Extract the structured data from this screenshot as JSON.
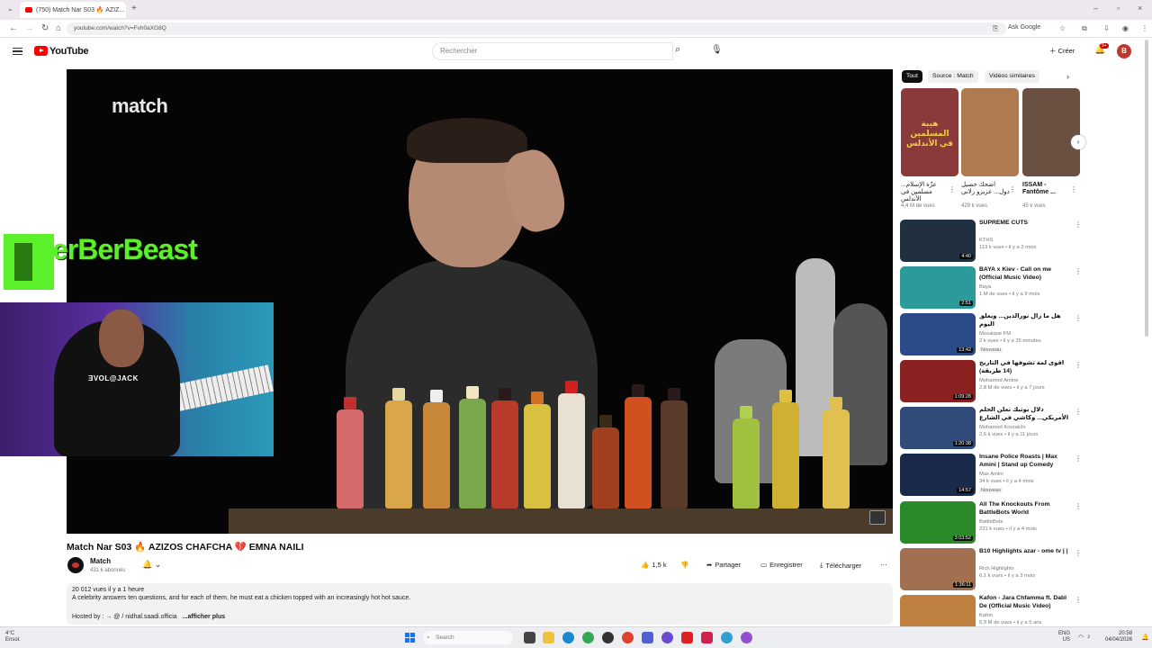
{
  "browser": {
    "tab_title": "(750) Match Nar S03 🔥 AZIZ...",
    "url": "youtube.com/watch?v=Fvh0aXG8Q",
    "ask_google": "Ask Google"
  },
  "header": {
    "logo_text": "YouTube",
    "search_placeholder": "Rechercher",
    "create_label": "Créer",
    "notif_count": "9+",
    "avatar_letter": "B"
  },
  "player": {
    "watermark": "match",
    "overlay_title": "erBerBeast",
    "overlay_shirt": "ƎVOL@JACK"
  },
  "video": {
    "title": "Match Nar S03 🔥 AZIZOS CHAFCHA 💔 EMNA NAILI",
    "channel": "Match",
    "subscribers": "431 k abonnés",
    "likes": "1,5 k",
    "share": "Partager",
    "save": "Enregistrer",
    "download": "Télécharger",
    "stats": "20 012 vues  il y a 1 heure",
    "description": "A celebrity answers ten questions, and for each of them, he must eat a chicken topped with an increasingly hot hot sauce.",
    "hosted_by": "Hosted by : → @ / nidhal.saadi.officia",
    "more": "...afficher plus"
  },
  "sidebar": {
    "chips": [
      "Tout",
      "Source : Match",
      "Vidéos similaires"
    ],
    "shorts": [
      {
        "title": "عزّة الإسلام... مسلمين في الأندلس",
        "views": "4,4 M de vues",
        "thumb_text": "هيبة المسلمين في الأندلس",
        "color": "#8a3a3a"
      },
      {
        "title": "اضحك حصيل دول... عزيزو رلاني",
        "views": "429 k vues",
        "color": "#b07a50"
      },
      {
        "title": "ISSAM - Fantôme ...",
        "views": "45 k vues",
        "color": "#6a5040"
      }
    ],
    "recommendations": [
      {
        "title": "SUPREME CUTS",
        "channel": "KTHS",
        "meta": "113 k vues • il y a 2 mois",
        "duration": "4:40",
        "color": "#203040"
      },
      {
        "title": "BAYA x Kiev - Call on me (Official Music Video)",
        "channel": "Baya",
        "meta": "1 M de vues • il y a 9 mois",
        "duration": "2:51",
        "color": "#2a9a9a"
      },
      {
        "title": "هل ما زال نورالدين... ويعلق اليوم",
        "channel": "Mosaique FM",
        "meta": "2 k vues • il y a 35 minutes",
        "duration": "13:42",
        "color": "#2a4a8a",
        "badge": "Nouveau"
      },
      {
        "title": "أقوى لمة تشوفها في التاريخ (14 طريقة)",
        "channel": "Mohamed Amine",
        "meta": "2,8 M de vues • il y a 7 jours",
        "duration": "1:09:28",
        "color": "#8a2020"
      },
      {
        "title": "دلال بوتيك تعلن الحلم الأمريكي... وكاشي في الشارع",
        "channel": "Mohamed Kouraichi",
        "meta": "2,6 k vues • il y a 11 jours",
        "duration": "1:20:38",
        "color": "#304a7a"
      },
      {
        "title": "Insane Police Roasts | Max Amini | Stand up Comedy",
        "channel": "Max Amini",
        "meta": "34 k vues • il y a 4 mois",
        "duration": "14:57",
        "color": "#1a2a4a",
        "badge": "Nouveau"
      },
      {
        "title": "All The Knockouts From BattleBots World Championship",
        "channel": "BattleBots",
        "meta": "231 k vues • il y a 4 mois",
        "duration": "3:03:52",
        "color": "#2a8a2a"
      },
      {
        "title": "B10 Highlights azar - ome tv | |",
        "channel": "Rich Highlights",
        "meta": "6,1 k vues • il y a 3 mois",
        "duration": "1:36:11",
        "color": "#a07050"
      },
      {
        "title": "Kafon - Jara Chfamma ft. Dabl De (Official Music Video)",
        "channel": "Kafon",
        "meta": "5,9 M de vues • il y a 5 ans",
        "duration": "",
        "color": "#c08040"
      }
    ]
  },
  "taskbar": {
    "weather_temp": "4°C",
    "weather_desc": "Ensol.",
    "search": "Search",
    "lang": "ENG",
    "lang2": "US",
    "time": "20:58",
    "date": "04/04/2026"
  }
}
